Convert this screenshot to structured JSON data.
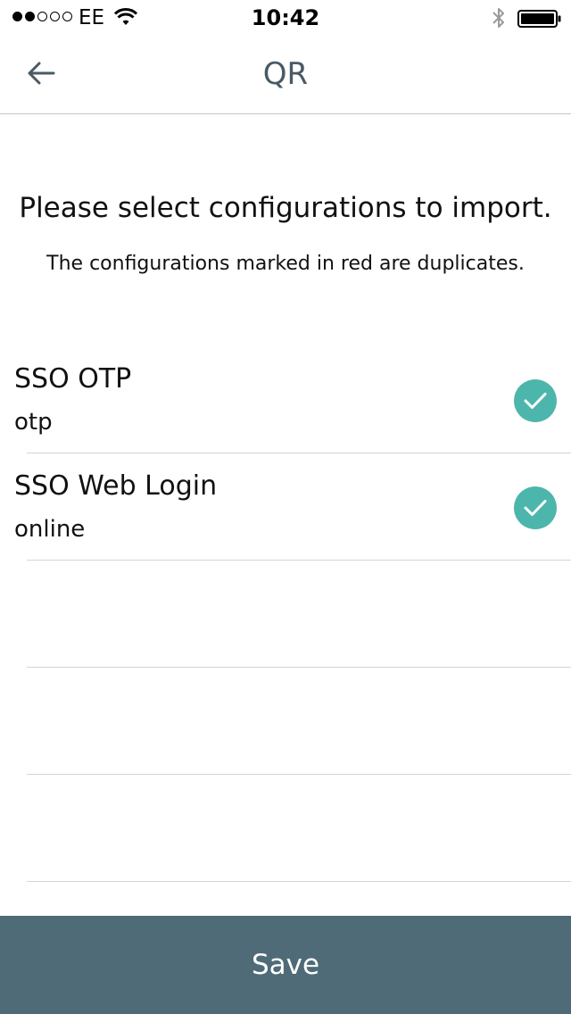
{
  "status_bar": {
    "signal_strength": [
      true,
      true,
      false,
      false,
      false
    ],
    "carrier": "EE",
    "time": "10:42",
    "icons": [
      "wifi-icon",
      "bluetooth-icon",
      "battery-icon"
    ]
  },
  "nav": {
    "back_icon": "arrow-left-icon",
    "title": "QR"
  },
  "main": {
    "heading": "Please select configurations to import.",
    "subheading": "The configurations marked in red are duplicates."
  },
  "configurations": [
    {
      "name": "SSO OTP",
      "type": "otp",
      "selected": true
    },
    {
      "name": "SSO Web Login",
      "type": "online",
      "selected": true
    }
  ],
  "footer": {
    "save_label": "Save"
  },
  "colors": {
    "accent": "#4db6ac",
    "save_bar": "#4f6b78",
    "title": "#4a5a64",
    "divider": "#d4d4d4"
  }
}
